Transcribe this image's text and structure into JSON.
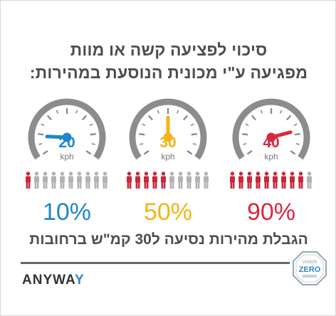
{
  "title_line1": "סיכוי לפציעה קשה או מוות",
  "title_line2": "מפגיעה ע\"י מכונית הנוסעת במהירות:",
  "gauges": [
    {
      "speed": "20",
      "unit": "kph",
      "color": "#1f87c9",
      "needle_level": 0.15
    },
    {
      "speed": "30",
      "unit": "kph",
      "color": "#f2b418",
      "needle_level": 0.5
    },
    {
      "speed": "40",
      "unit": "kph",
      "color": "#d9283e",
      "needle_level": 0.8
    }
  ],
  "risk": [
    {
      "percent_label": "10%",
      "red_of_ten": 1,
      "color": "#1f87c9"
    },
    {
      "percent_label": "50%",
      "red_of_ten": 5,
      "color": "#f2b418"
    },
    {
      "percent_label": "90%",
      "red_of_ten": 9,
      "color": "#d9283e"
    }
  ],
  "person_colors": {
    "red": "#c9283a",
    "gray": "#b3b3b3"
  },
  "bottom_text": "הגבלת מהירות נסיעה ל30 קמ\"ש ברחובות",
  "logo": {
    "part1": "ANYWA",
    "part2": "Y"
  },
  "badge": {
    "top": "VISION",
    "main": "ZERO"
  }
}
